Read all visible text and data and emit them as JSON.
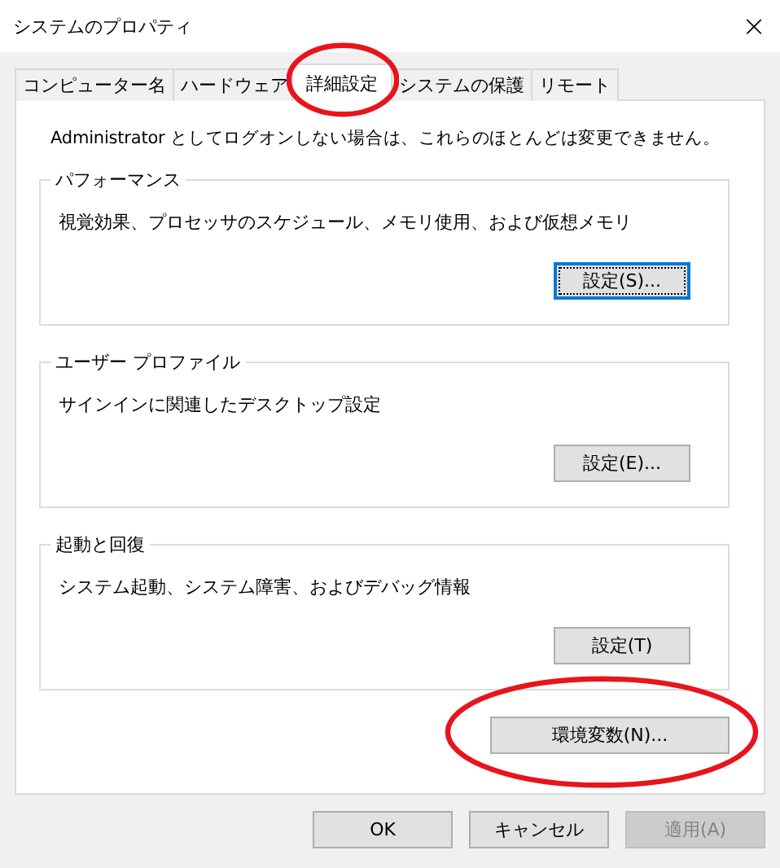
{
  "window": {
    "title": "システムのプロパティ",
    "close": "×"
  },
  "tabs": [
    {
      "label": "コンピューター名",
      "selected": false,
      "circled": false
    },
    {
      "label": "ハードウェア",
      "selected": false,
      "circled": false
    },
    {
      "label": "詳細設定",
      "selected": true,
      "circled": true
    },
    {
      "label": "システムの保護",
      "selected": false,
      "circled": false
    },
    {
      "label": "リモート",
      "selected": false,
      "circled": false
    }
  ],
  "notice": "Administrator としてログオンしない場合は、これらのほとんどは変更できません。",
  "groups": [
    {
      "title": "パフォーマンス",
      "description": "視覚効果、プロセッサのスケジュール、メモリ使用、および仮想メモリ",
      "button": {
        "label": "設定(S)...",
        "focused": true
      }
    },
    {
      "title": "ユーザー プロファイル",
      "description": "サインインに関連したデスクトップ設定",
      "button": {
        "label": "設定(E)...",
        "focused": false
      }
    },
    {
      "title": "起動と回復",
      "description": "システム起動、システム障害、およびデバッグ情報",
      "button": {
        "label": "設定(T)",
        "focused": false
      }
    }
  ],
  "env_button": {
    "label": "環境変数(N)...",
    "circled": true
  },
  "dialog_buttons": [
    {
      "label": "OK",
      "disabled": false
    },
    {
      "label": "キャンセル",
      "disabled": false
    },
    {
      "label": "適用(A)",
      "disabled": true
    }
  ]
}
